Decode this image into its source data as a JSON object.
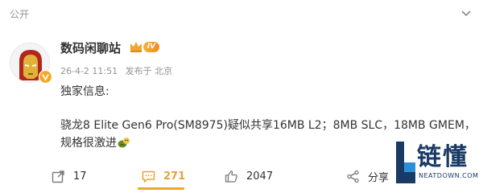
{
  "post": {
    "visibility": "公开",
    "author": {
      "name": "数码闲聊站",
      "level_badge": "IV"
    },
    "meta": {
      "timestamp": "26-4-2 11:51",
      "location": "发布于 北京"
    },
    "content": {
      "line1": "独家信息:",
      "line2": "骁龙8 Elite Gen6 Pro(SM8975)疑似共享16MB L2；8MB SLC，18MB GMEM，",
      "line3": "规格很激进"
    },
    "actions": {
      "repost_count": "17",
      "comment_count": "271",
      "like_count": "2047",
      "share_label": "分享"
    }
  },
  "watermark": {
    "brand": "链懂",
    "domain": "NEATDOWN.COM"
  },
  "colors": {
    "accent": "#f0a52e",
    "muted_text": "#939393",
    "watermark": "#1a3a66"
  },
  "icons": [
    "chevron-down-icon",
    "verified-v-icon",
    "crown-icon",
    "repost-icon",
    "comment-icon",
    "like-icon",
    "share-icon",
    "avatar-ironman-image"
  ]
}
